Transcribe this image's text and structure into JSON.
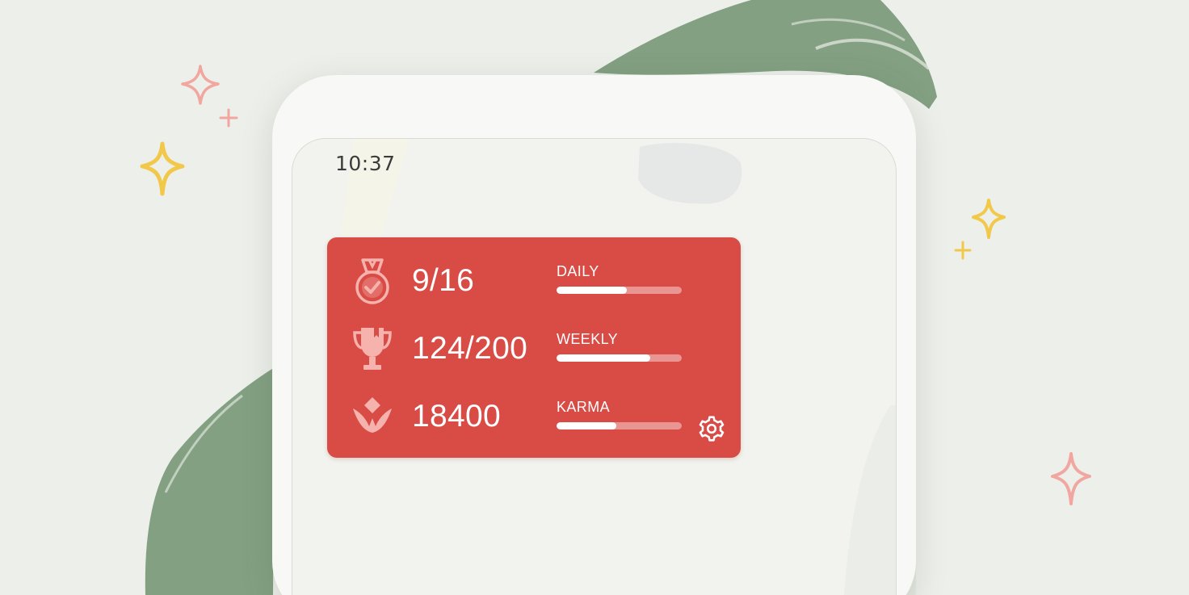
{
  "status_bar": {
    "time": "10:37"
  },
  "widget": {
    "stats": [
      {
        "id": "daily",
        "icon": "medal-icon",
        "value": "9/16",
        "label": "DAILY",
        "progress": 0.5625
      },
      {
        "id": "weekly",
        "icon": "trophy-icon",
        "value": "124/200",
        "label": "WEEKLY",
        "progress": 0.75
      },
      {
        "id": "karma",
        "icon": "karma-flower-icon",
        "value": "18400",
        "label": "KARMA",
        "progress": 0.48
      }
    ],
    "settings_icon": "gear-icon"
  },
  "colors": {
    "widget_bg": "#d94b45",
    "brush_green": "#7d9b7c",
    "sparkle_pink": "#f2a6a0",
    "sparkle_yellow": "#f2c84b"
  }
}
